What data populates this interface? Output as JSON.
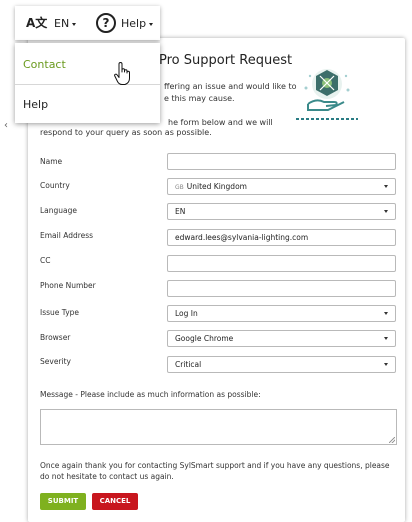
{
  "page": {
    "title": "Pro Support Request",
    "intro_line1": "ffering an issue and would like to",
    "intro_line2": "e this may cause.",
    "intro_line3": "he form below and we will",
    "intro_line4": "respond to your query as soon as possible."
  },
  "topbar": {
    "language_icon": "A文",
    "language_label": "EN",
    "help_icon": "?",
    "help_label": "Help"
  },
  "popup": {
    "items": [
      {
        "label": "Contact",
        "active": true
      },
      {
        "label": "Help",
        "active": false
      }
    ]
  },
  "form": {
    "name": {
      "label": "Name",
      "value": ""
    },
    "country": {
      "label": "Country",
      "flag": "GB",
      "value": "United Kingdom"
    },
    "language": {
      "label": "Language",
      "value": "EN"
    },
    "email": {
      "label": "Email Address",
      "value": "edward.lees@sylvania-lighting.com"
    },
    "cc": {
      "label": "CC",
      "value": ""
    },
    "phone": {
      "label": "Phone Number",
      "value": ""
    },
    "issue_type": {
      "label": "Issue Type",
      "value": "Log In"
    },
    "browser": {
      "label": "Browser",
      "value": "Google Chrome"
    },
    "severity": {
      "label": "Severity",
      "value": "Critical"
    },
    "message_label": "Message - Please include as much information as possible:",
    "message_value": ""
  },
  "footer": {
    "thanks_line1": "Once again thank you for contacting SylSmart support and if you have any questions, please",
    "thanks_line2": "do not hesitate to contact us again.",
    "submit_label": "SUBMIT",
    "cancel_label": "CANCEL"
  },
  "colors": {
    "accent_green": "#7fb11f",
    "danger_red": "#c8161e",
    "link_green": "#6a9a1e"
  }
}
